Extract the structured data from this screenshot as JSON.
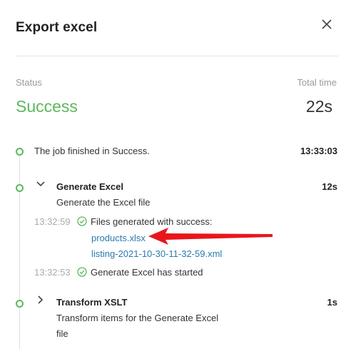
{
  "dialog": {
    "title": "Export excel",
    "close_icon": "close-icon"
  },
  "summary": {
    "status_label": "Status",
    "status_value": "Success",
    "time_label": "Total time",
    "time_value": "22s",
    "success_color": "#5cb85c"
  },
  "timeline": {
    "finished": {
      "text": "The job finished in Success.",
      "time": "13:33:03"
    },
    "generate": {
      "title": "Generate Excel",
      "duration": "12s",
      "description": "Generate the Excel file",
      "logs": [
        {
          "time": "13:32:59",
          "text": "Files generated with success:",
          "files": [
            "products.xlsx",
            "listing-2021-10-30-11-32-59.xml"
          ]
        },
        {
          "time": "13:32:53",
          "text": "Generate Excel has started"
        }
      ]
    },
    "transform": {
      "title": "Transform XSLT",
      "duration": "1s",
      "description_line1": "Transform items for the Generate Excel",
      "description_line2": "file"
    }
  },
  "annotation": {
    "arrow_color": "#e8161b",
    "arrow_target": "products.xlsx"
  }
}
